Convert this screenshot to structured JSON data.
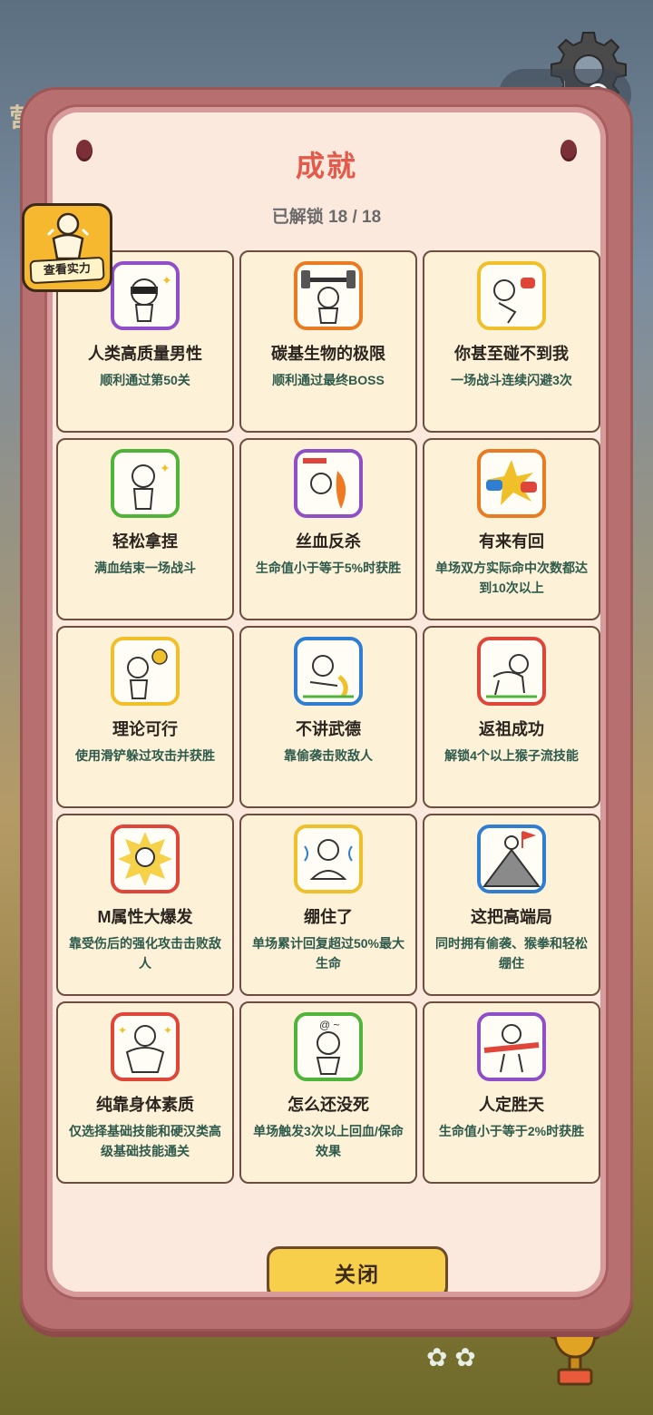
{
  "modal": {
    "title": "成就",
    "unlock_status": "已解锁 18 / 18",
    "close_label": "关闭"
  },
  "side_badge": {
    "label": "查看实力"
  },
  "background": {
    "partial_letter": "营"
  },
  "colors": {
    "title": "#e45a4a",
    "desc": "#2d5a4c",
    "button": "#f8cf4a"
  },
  "achievements": [
    {
      "name": "人类高质量男性",
      "desc": "顺利通过第50关",
      "icon": "sunglasses-man-icon",
      "frame": "#8e4fc9"
    },
    {
      "name": "碳基生物的极限",
      "desc": "顺利通过最终BOSS",
      "icon": "weightlifter-icon",
      "frame": "#e97b22"
    },
    {
      "name": "你甚至碰不到我",
      "desc": "一场战斗连续闪避3次",
      "icon": "dodge-punch-icon",
      "frame": "#f0c02a"
    },
    {
      "name": "轻松拿捏",
      "desc": "满血结束一场战斗",
      "icon": "thumbs-up-man-icon",
      "frame": "#4fb53a"
    },
    {
      "name": "丝血反杀",
      "desc": "生命值小于等于5%时获胜",
      "icon": "low-hp-fire-icon",
      "frame": "#8e4fc9"
    },
    {
      "name": "有来有回",
      "desc": "单场双方实际命中次数都达到10次以上",
      "icon": "clashing-fists-icon",
      "frame": "#e97b22"
    },
    {
      "name": "理论可行",
      "desc": "使用滑铲躲过攻击并获胜",
      "icon": "lightbulb-man-icon",
      "frame": "#f0c02a"
    },
    {
      "name": "不讲武德",
      "desc": "靠偷袭击败敌人",
      "icon": "banana-man-icon",
      "frame": "#2f7ed1"
    },
    {
      "name": "返祖成功",
      "desc": "解锁4个以上猴子流技能",
      "icon": "crawling-monkey-icon",
      "frame": "#e0453a"
    },
    {
      "name": "M属性大爆发",
      "desc": "靠受伤后的强化攻击击败敌人",
      "icon": "burst-man-icon",
      "frame": "#e0453a"
    },
    {
      "name": "绷住了",
      "desc": "单场累计回复超过50%最大生命",
      "icon": "meditating-man-icon",
      "frame": "#f0c02a"
    },
    {
      "name": "这把高端局",
      "desc": "同时拥有偷袭、猴拳和轻松绷住",
      "icon": "mountain-flag-icon",
      "frame": "#2f7ed1"
    },
    {
      "name": "纯靠身体素质",
      "desc": "仅选择基础技能和硬汉类高级基础技能通关",
      "icon": "strong-man-icon",
      "frame": "#e0453a"
    },
    {
      "name": "怎么还没死",
      "desc": "单场触发3次以上回血/保命效果",
      "icon": "dizzy-man-icon",
      "frame": "#4fb53a"
    },
    {
      "name": "人定胜天",
      "desc": "生命值小于等于2%时获胜",
      "icon": "finish-line-icon",
      "frame": "#8e4fc9"
    }
  ]
}
